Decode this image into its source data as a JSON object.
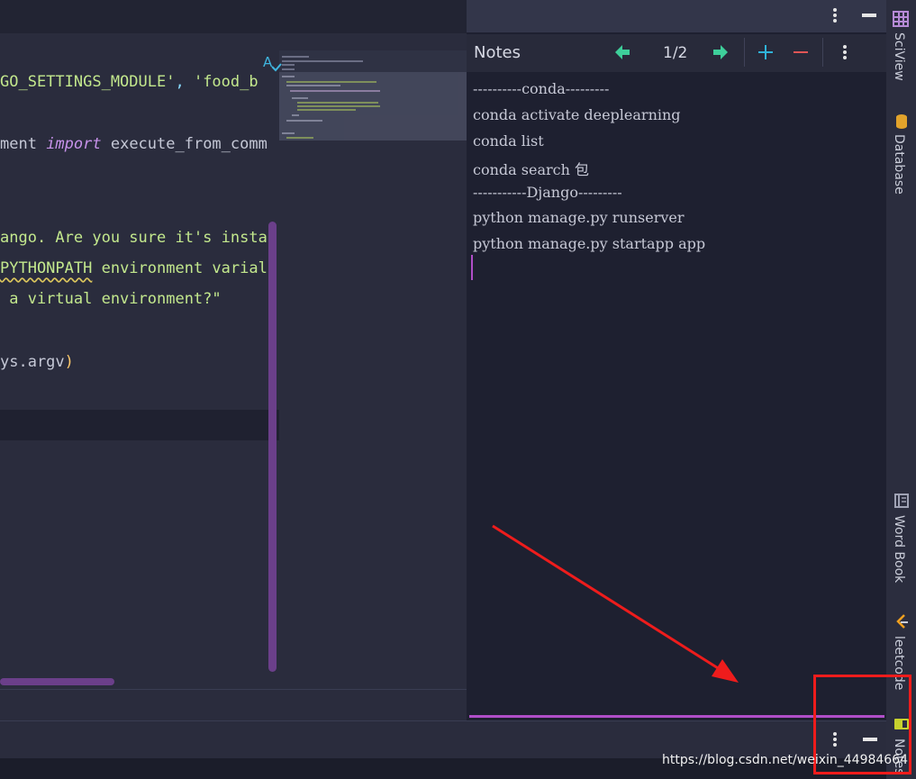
{
  "editor": {
    "lines": [
      {
        "pre": "",
        "str": "GO_SETTINGS_MODULE'",
        "mid": ", ",
        "str2": "'food_b",
        "post": ""
      },
      {
        "pre": "ment ",
        "kw": "import",
        "post": " execute_from_comm"
      },
      {
        "str": "ango. Are you sure it's insta"
      },
      {
        "squiggle": "PYTHONPATH",
        "str": " environment varial"
      },
      {
        "str": " a virtual environment?\""
      },
      {
        "pre": "ys.argv",
        "paren": ")"
      }
    ]
  },
  "notes": {
    "title": "Notes",
    "page_indicator": "1/2",
    "lines": [
      "----------conda---------",
      "conda activate deeplearning",
      "conda list",
      "conda search 包",
      "-----------Django---------",
      "python manage.py runserver",
      "python manage.py startapp app"
    ]
  },
  "right_stripe": {
    "tabs": [
      {
        "label": "SciView",
        "icon": "grid-icon"
      },
      {
        "label": "Database",
        "icon": "database-icon"
      },
      {
        "label": "Word Book",
        "icon": "book-icon"
      },
      {
        "label": "leetcode",
        "icon": "leetcode-icon"
      },
      {
        "label": "Notes",
        "icon": "notes-icon"
      }
    ]
  },
  "watermark": "https://blog.csdn.net/weixin_44984664",
  "colors": {
    "accent": "#b04ec8",
    "annotation": "#ee1c1c",
    "go_next": "#3ecf9a",
    "add": "#2fb3d9",
    "remove": "#e05555"
  }
}
